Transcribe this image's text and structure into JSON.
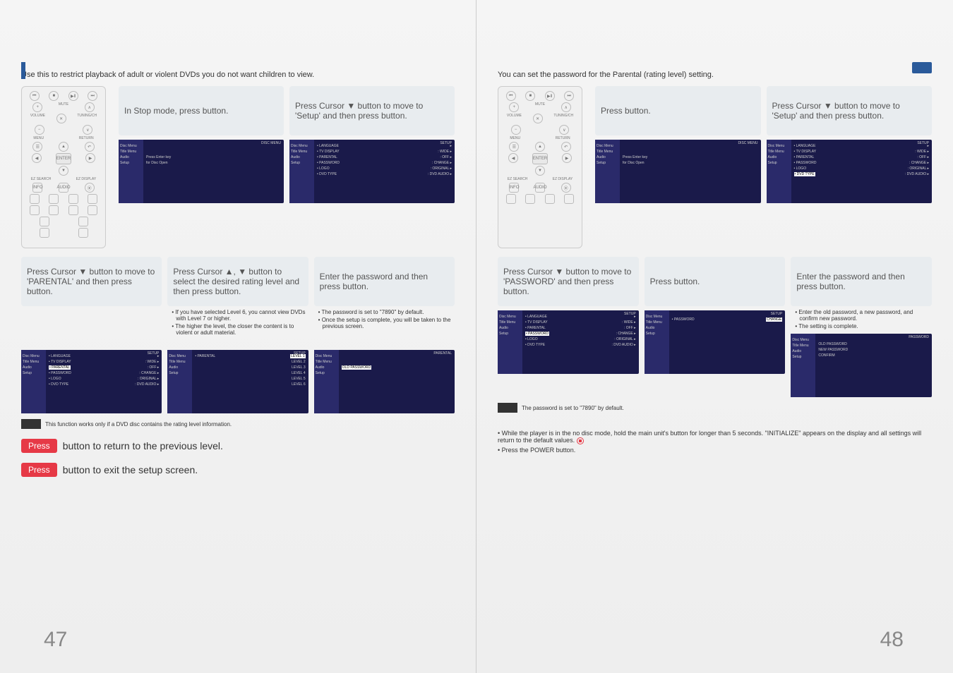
{
  "left": {
    "intro": "Use this to restrict playback of adult or violent DVDs you do not want children to view.",
    "step1": "In Stop mode, press button.",
    "step2": "Press Cursor ▼ button to move to 'Setup' and then press button.",
    "step3": "Press Cursor ▼ button to move to 'PARENTAL' and then press button.",
    "step4": "Press Cursor ▲, ▼ button to select the desired rating level and then press button.",
    "step4_bullets": [
      "If you have selected Level 6, you cannot view DVDs with Level 7 or higher.",
      "The higher the level, the closer the content is to violent or adult material."
    ],
    "step5": "Enter the password and then press button.",
    "step5_bullets": [
      "The password is set to \"7890\" by default.",
      "Once the setup is complete, you will be taken to the previous screen."
    ],
    "note": "This function works only if a DVD disc contains the rating level information.",
    "footer1_pill": "Press",
    "footer1_text": "button to return to the previous level.",
    "footer2_pill": "Press",
    "footer2_text": "button to exit the setup screen.",
    "pagenum": "47",
    "remote": {
      "menu": "MENU",
      "return": "RETURN",
      "enter": "ENTER",
      "mute": "MUTE",
      "vol": "VOLUME",
      "tun": "TUNING/CH",
      "ezs": "EZ SEARCH",
      "ezd": "EZ DISPLAY",
      "info": "INFO",
      "audio": "AUDIO"
    },
    "shot_disc": {
      "hdr": "DISC MENU",
      "items": [
        "Disc Menu",
        "Title Menu",
        "Audio",
        "Setup"
      ],
      "msg1": "Press Enter key",
      "msg2": "for Disc Open"
    },
    "shot_setup": {
      "hdr": "SETUP",
      "items": [
        "LANGUAGE",
        "TV DISPLAY",
        "PARENTAL",
        "PASSWORD",
        "LOGO",
        "DVD TYPE"
      ],
      "vals": [
        "",
        "WIDE",
        "OFF",
        "CHANGE",
        "ORIGINAL",
        "DVD AUDIO"
      ]
    },
    "shot_parental": {
      "hdr": "SETUP",
      "side": "PARENTAL",
      "levels": [
        "LEVEL 1",
        "LEVEL 2",
        "LEVEL 3",
        "LEVEL 4",
        "LEVEL 5",
        "LEVEL 6"
      ]
    },
    "shot_pwd": {
      "hdr": "PARENTAL",
      "lbl": "OLD PASSWORD"
    }
  },
  "right": {
    "intro": "You can set the password for the Parental (rating level) setting.",
    "step1": "Press button.",
    "step2": "Press Cursor ▼ button to move to 'Setup' and then press button.",
    "step3": "Press Cursor ▼ button to move to 'PASSWORD' and then press button.",
    "step4": "Press button.",
    "step5": "Enter the password and then press button.",
    "step5_bullets": [
      "Enter the old password, a new password, and confirm new password.",
      "The setting is complete."
    ],
    "note": "The password is set to \"7890\" by default.",
    "reset": [
      "While the player is in the no disc mode, hold the main unit's         button for longer than 5 seconds. \"INITIALIZE\" appears on the display and all settings will return to the default values.",
      "Press the POWER button."
    ],
    "pagenum": "48",
    "shot_pwd2": {
      "hdr": "SETUP",
      "item": "PASSWORD",
      "val": "CHANGE"
    },
    "shot_pwd3": {
      "hdr": "PASSWORD",
      "l1": "OLD PASSWORD",
      "l2": "NEW PASSWORD",
      "l3": "CONFIRM"
    }
  }
}
